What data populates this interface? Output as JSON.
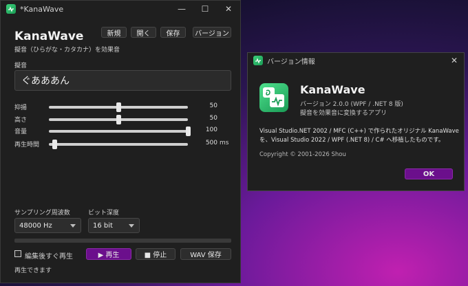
{
  "main": {
    "title": "*KanaWave",
    "app_name": "KanaWave",
    "subtitle": "擬音（ひらがな・カタカナ）を効果音",
    "menu": {
      "new": "新規",
      "open": "開く",
      "save": "保存",
      "version": "バージョン"
    },
    "input_label": "擬音",
    "input_value": "ぐあああん",
    "sliders": [
      {
        "label": "抑揚",
        "value": "50",
        "unit": "",
        "fraction": 0.5
      },
      {
        "label": "高さ",
        "value": "50",
        "unit": "",
        "fraction": 0.5
      },
      {
        "label": "音量",
        "value": "100",
        "unit": "",
        "fraction": 1.0
      },
      {
        "label": "再生時間",
        "value": "500",
        "unit": "ms",
        "fraction": 0.04
      }
    ],
    "sampling_label": "サンプリング周波数",
    "sampling_value": "48000 Hz",
    "bitdepth_label": "ビット深度",
    "bitdepth_value": "16 bit",
    "checkbox_label": "編集後すぐ再生",
    "checkbox_checked": false,
    "play_label": "▶ 再生",
    "stop_label": "■ 停止",
    "wav_save_label": "WAV 保存",
    "status": "再生できます"
  },
  "about": {
    "title": "バージョン情報",
    "app_name": "KanaWave",
    "version": "バージョン 2.0.0 (WPF / .NET 8 版)",
    "description": "擬音を効果音に変換するアプリ",
    "body_line1": "Visual Studio.NET 2002 / MFC (C++) で作られたオリジナル KanaWave",
    "body_line2": "を、Visual Studio 2022 / WPF (.NET 8) / C# へ移植したものです。",
    "copyright": "Copyright © 2001-2026 Shou",
    "ok_label": "OK",
    "close_glyph": "✕"
  },
  "caption_glyphs": {
    "minimize": "—",
    "maximize": "☐",
    "close": "✕"
  },
  "colors": {
    "accent": "#6b0f8c",
    "icon_green": "#2bbf6a",
    "window_bg": "#1f1f1f"
  }
}
